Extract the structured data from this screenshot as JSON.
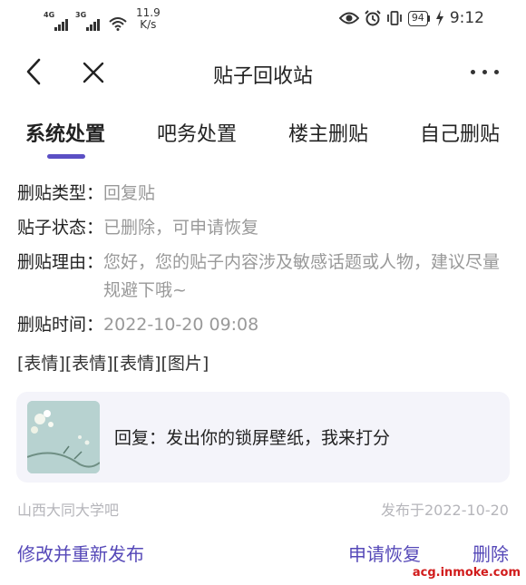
{
  "status_bar": {
    "network1": "4G",
    "network2": "3G",
    "speed_value": "11.9",
    "speed_unit": "K/s",
    "battery": "94",
    "time": "9:12"
  },
  "nav": {
    "title": "贴子回收站"
  },
  "tabs": [
    {
      "label": "系统处置",
      "active": true
    },
    {
      "label": "吧务处置",
      "active": false
    },
    {
      "label": "楼主删贴",
      "active": false
    },
    {
      "label": "自己删贴",
      "active": false
    }
  ],
  "details": {
    "type_label": "删贴类型：",
    "type_value": "回复贴",
    "status_label": "贴子状态：",
    "status_value": "已删除，可申请恢复",
    "reason_label": "删贴理由：",
    "reason_value": "您好，您的贴子内容涉及敏感话题或人物，建议尽量规避下哦~",
    "time_label": "删贴时间：",
    "time_value": "2022-10-20 09:08"
  },
  "post": {
    "content": "[表情][表情][表情][图片]",
    "reply_text": "回复：发出你的锁屏壁纸，我来打分"
  },
  "footer": {
    "forum": "山西大同大学吧",
    "published": "发布于2022-10-20",
    "edit_label": "修改并重新发布",
    "restore_label": "申请恢复",
    "delete_label": "删除"
  },
  "watermark": "acg.inmoke.com",
  "colors": {
    "accent": "#5548b8",
    "indicator": "#5b4fc4",
    "muted": "#999999",
    "card_bg": "#f4f4fa"
  },
  "icons": [
    "back-icon",
    "close-icon",
    "more-icon",
    "eye-icon",
    "alarm-icon",
    "vibrate-icon",
    "charging-icon",
    "wifi-icon",
    "signal-icon"
  ]
}
